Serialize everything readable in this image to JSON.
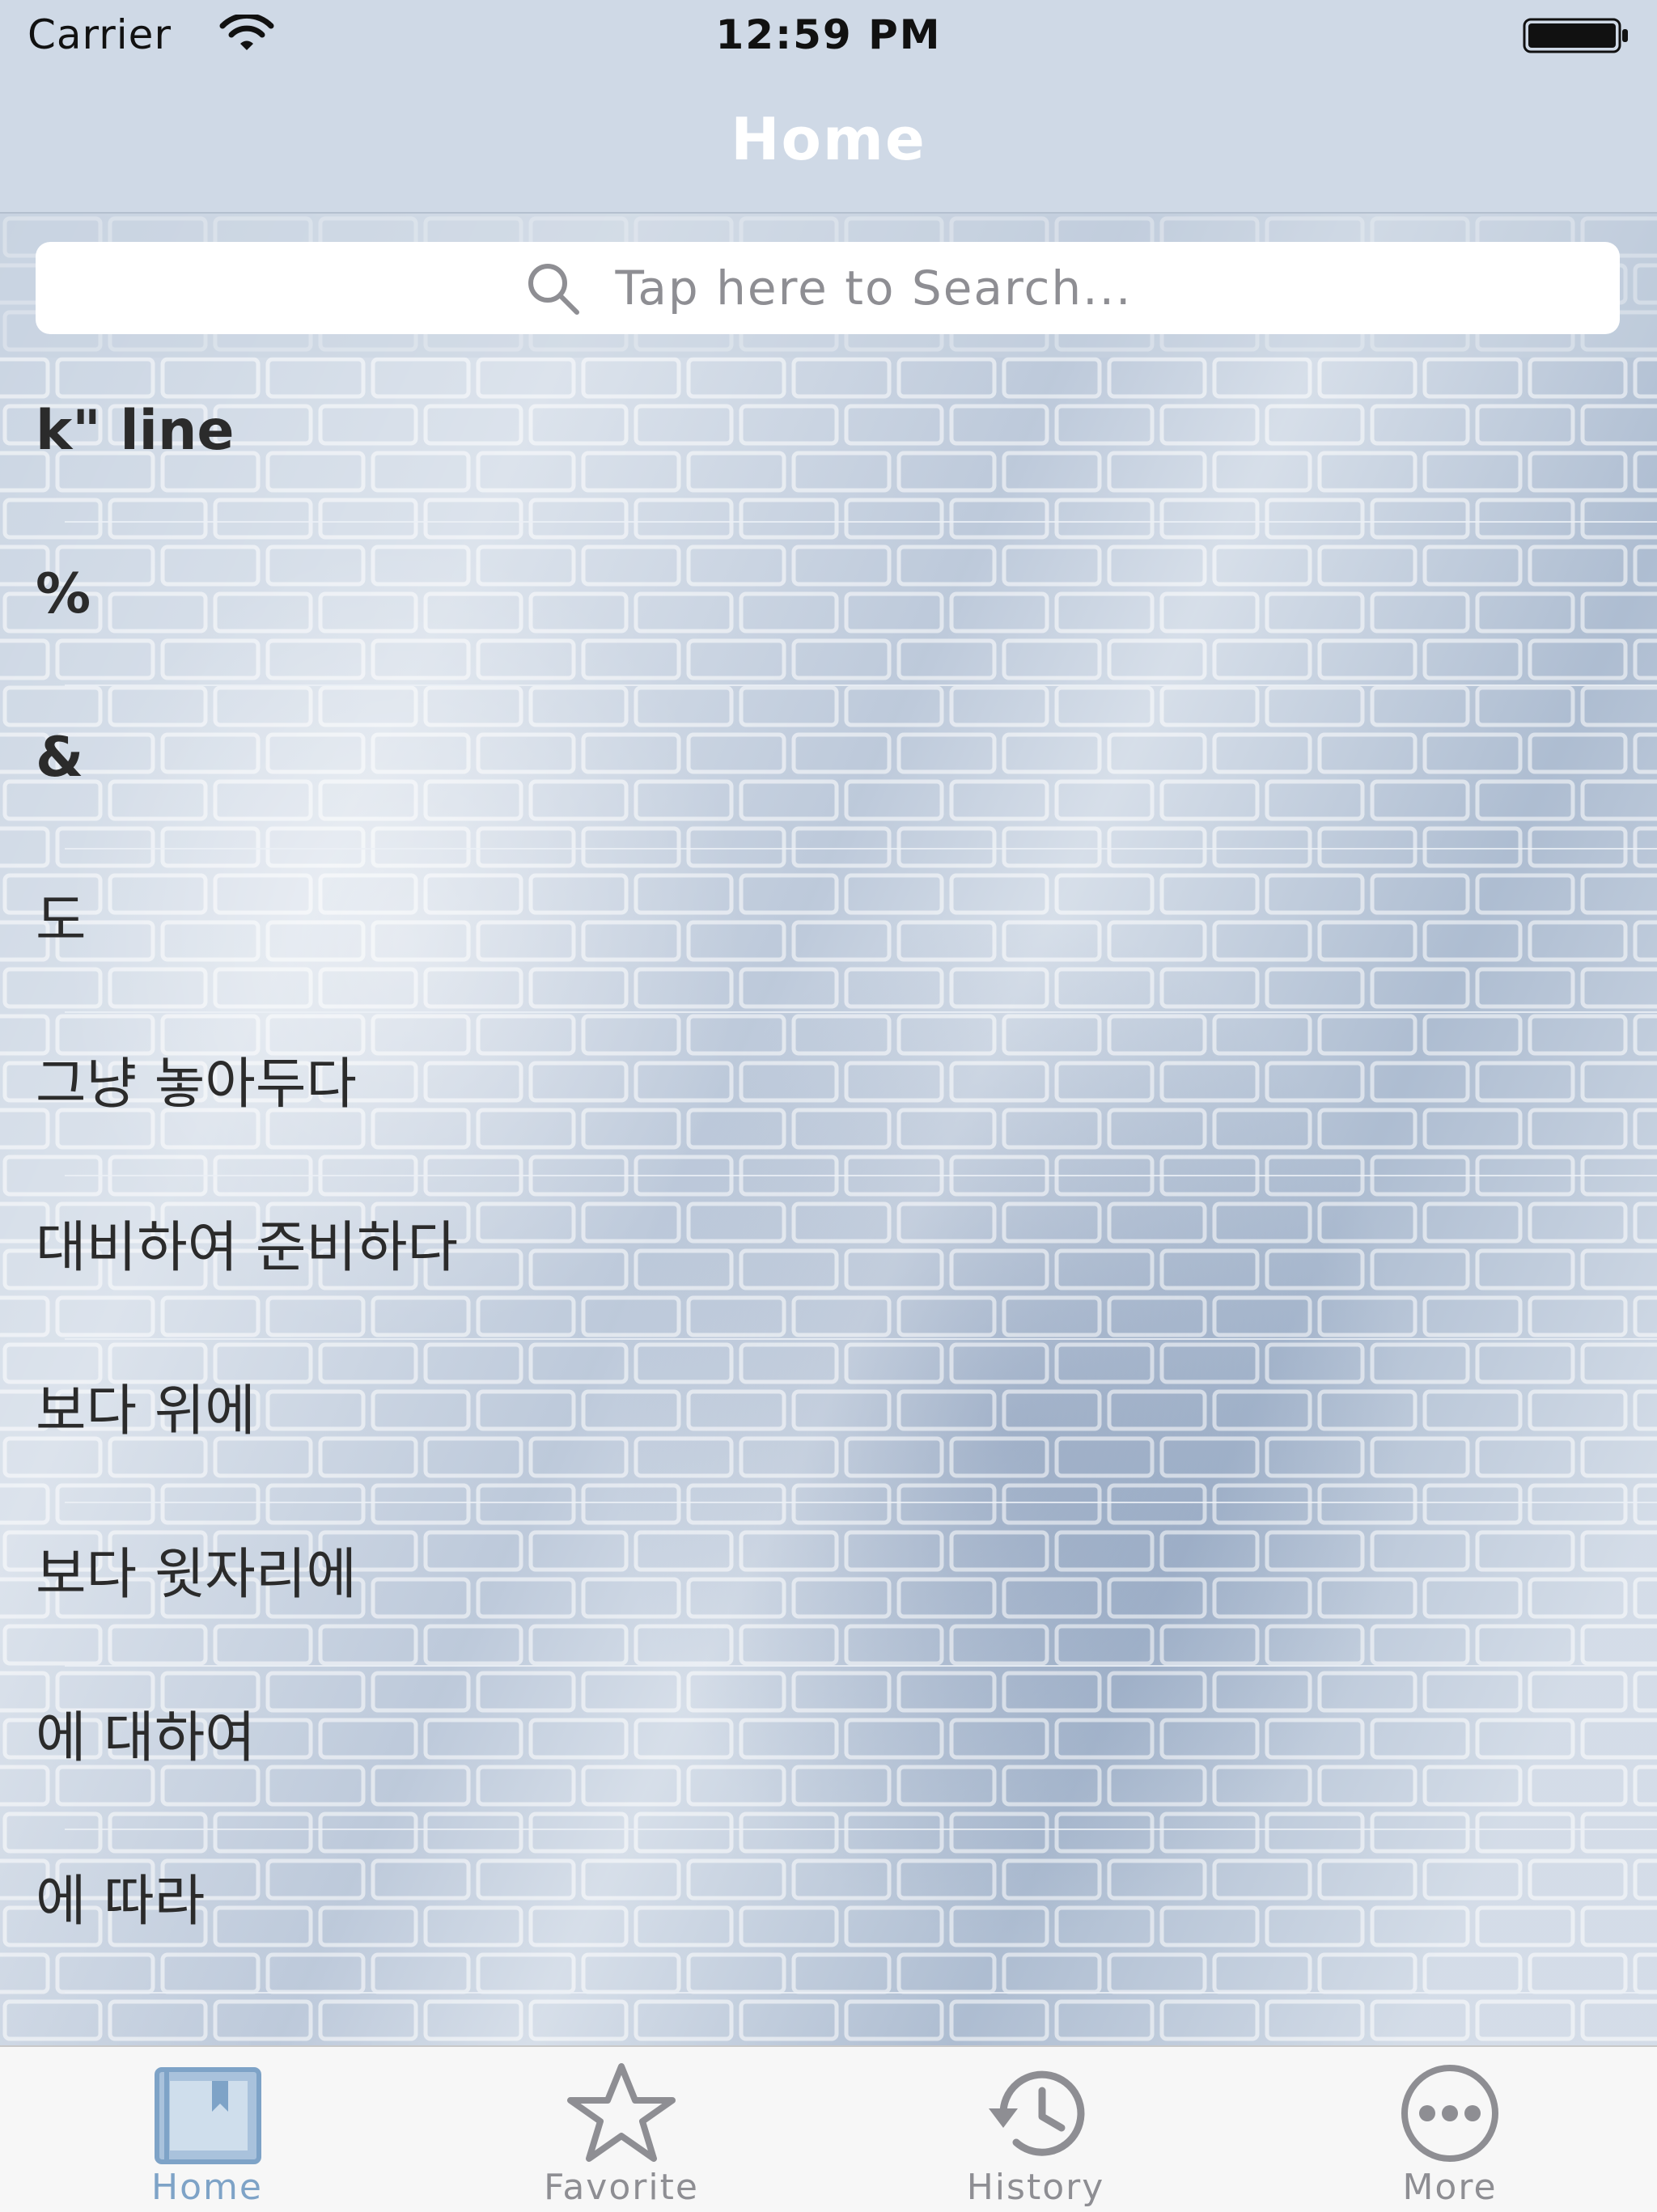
{
  "status_bar": {
    "carrier": "Carrier",
    "time": "12:59 PM",
    "wifi_icon": "wifi-icon",
    "battery_icon": "battery-icon"
  },
  "nav": {
    "title": "Home"
  },
  "search": {
    "placeholder": "Tap here to Search...",
    "icon": "search-icon"
  },
  "words": [
    {
      "label": "k\" line"
    },
    {
      "label": "%"
    },
    {
      "label": "&"
    },
    {
      "label": "도"
    },
    {
      "label": "그냥 놓아두다"
    },
    {
      "label": "대비하여 준비하다"
    },
    {
      "label": "보다 위에"
    },
    {
      "label": "보다 윗자리에"
    },
    {
      "label": "에 대하여"
    },
    {
      "label": "에 따라"
    }
  ],
  "tabs": [
    {
      "label": "Home",
      "icon": "book-icon",
      "active": true
    },
    {
      "label": "Favorite",
      "icon": "star-icon",
      "active": false
    },
    {
      "label": "History",
      "icon": "history-clock-icon",
      "active": false
    },
    {
      "label": "More",
      "icon": "more-dots-icon",
      "active": false
    }
  ],
  "colors": {
    "nav_background": "#cfd9e6",
    "active_tab": "#7ea3c7",
    "inactive_tab": "#8e8e93",
    "tab_bar_background": "#f7f7f7"
  }
}
